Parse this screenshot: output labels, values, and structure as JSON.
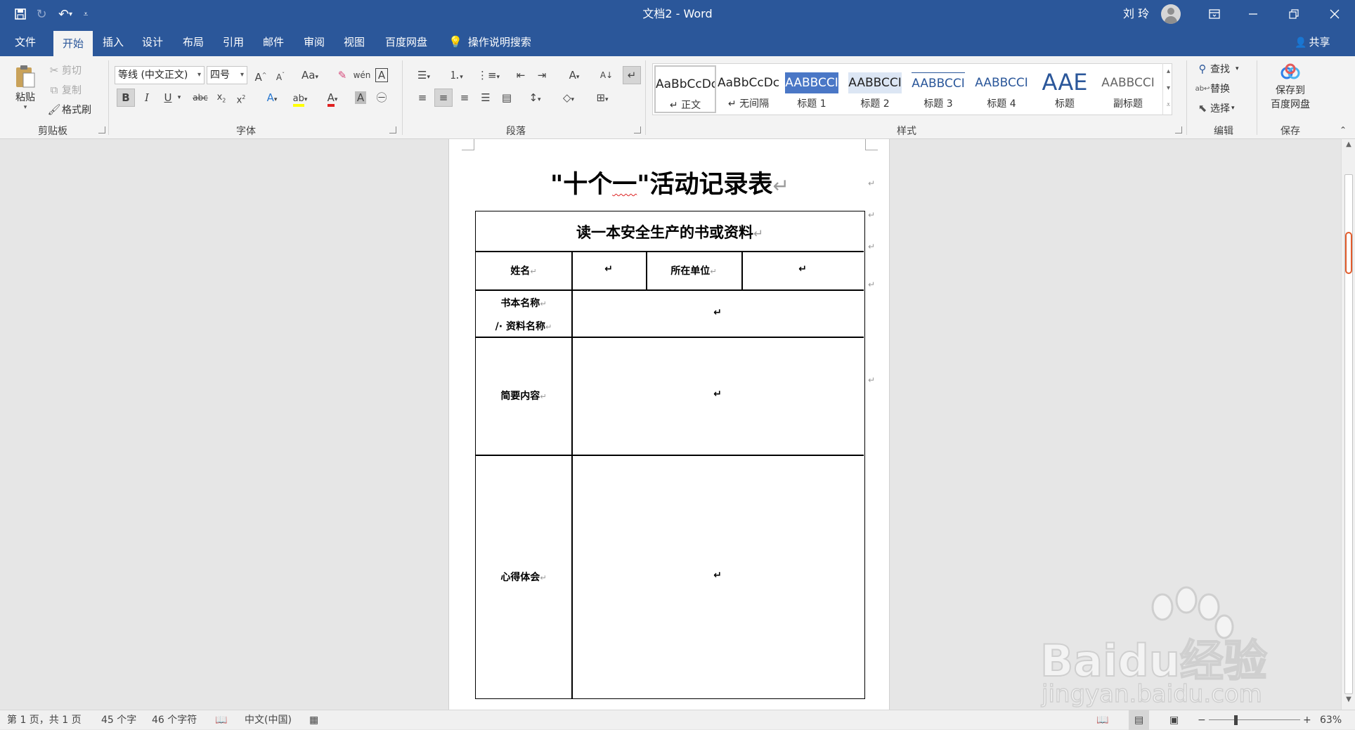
{
  "titlebar": {
    "title": "文档2  -  Word",
    "user": "刘 玲",
    "qat_more": "⩡"
  },
  "tabs": [
    {
      "label": "文件"
    },
    {
      "label": "开始"
    },
    {
      "label": "插入"
    },
    {
      "label": "设计"
    },
    {
      "label": "布局"
    },
    {
      "label": "引用"
    },
    {
      "label": "邮件"
    },
    {
      "label": "审阅"
    },
    {
      "label": "视图"
    },
    {
      "label": "百度网盘"
    }
  ],
  "tellme": "操作说明搜索",
  "share": "共享",
  "clipboard": {
    "paste": "粘贴",
    "cut": "剪切",
    "copy": "复制",
    "format_painter": "格式刷",
    "group": "剪贴板"
  },
  "font": {
    "name": "等线 (中文正文)",
    "size": "四号",
    "group": "字体",
    "bold": "B",
    "italic": "I",
    "underline": "U"
  },
  "paragraph": {
    "group": "段落"
  },
  "styles": {
    "group": "样式",
    "items": [
      {
        "sample": "AaBbCcDc",
        "name": "↵ 正文"
      },
      {
        "sample": "AaBbCcDc",
        "name": "↵ 无间隔"
      },
      {
        "sample": "AABBCCI",
        "name": "标题 1"
      },
      {
        "sample": "AABBCCI",
        "name": "标题 2"
      },
      {
        "sample": "AABBCCI",
        "name": "标题 3"
      },
      {
        "sample": "AABBCCI",
        "name": "标题 4"
      },
      {
        "sample": "AAE",
        "name": "标题"
      },
      {
        "sample": "AABBCCI",
        "name": "副标题"
      }
    ]
  },
  "editing": {
    "find": "查找",
    "replace": "替换",
    "select": "选择",
    "group": "编辑"
  },
  "save": {
    "label_line1": "保存到",
    "label_line2": "百度网盘",
    "group": "保存"
  },
  "document": {
    "title_pre": "\"十个",
    "title_wavy": "一",
    "title_post": "\"活动记录表",
    "table_heading": "读一本安全生产的书或资料",
    "row_name": "姓名",
    "row_unit": "所在单位",
    "row_book_1": "书本名称",
    "row_book_2": "/· 资料名称",
    "row_summary": "简要内容",
    "row_insight": "心得体会",
    "para_mark": "↵"
  },
  "statusbar": {
    "page": "第 1 页，共 1 页",
    "words": "45 个字",
    "chars": "46 个字符",
    "lang": "中文(中国)",
    "zoom": "63%"
  },
  "watermark": {
    "brand": "Baidu经验",
    "url": "jingyan.baidu.com"
  },
  "colors": {
    "accent": "#2b579a",
    "heading1_fill": "#4a77c6",
    "scroll_marker": "#e25c2c"
  }
}
